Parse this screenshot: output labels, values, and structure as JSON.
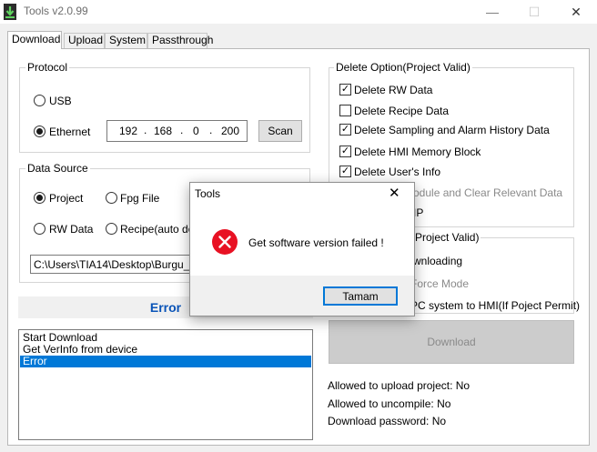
{
  "window": {
    "title": "Tools v2.0.99",
    "minimize": "—",
    "maximize": "☐",
    "close": "✕"
  },
  "tabs": [
    "Download",
    "Upload",
    "System",
    "Passthrough"
  ],
  "protocol": {
    "legend": "Protocol",
    "usb_label": "USB",
    "ethernet_label": "Ethernet",
    "selected": "Ethernet",
    "ip": [
      "192",
      "168",
      "0",
      "200"
    ],
    "scan_label": "Scan"
  },
  "data_source": {
    "legend": "Data Source",
    "project_label": "Project",
    "fpg_label": "Fpg File",
    "rw_label": "RW Data",
    "recipe_label": "Recipe(auto dele",
    "selected": "Project",
    "path": "C:\\Users\\TIA14\\Desktop\\Burgu_Ma"
  },
  "status_text": "Error",
  "log": [
    "Start Download",
    "Get VerInfo from device",
    "Error"
  ],
  "delete_options": {
    "legend": "Delete Option(Project Valid)",
    "items": [
      {
        "label": "Delete RW Data",
        "checked": "✓"
      },
      {
        "label": "Delete Recipe Data",
        "checked": ""
      },
      {
        "label": "Delete Sampling and Alarm History Data",
        "checked": "✓"
      },
      {
        "label": "Delete HMI Memory Block",
        "checked": "✓"
      },
      {
        "label": "Delete User's Info",
        "checked": "✓"
      }
    ],
    "partial_1": "odule and Clear Relevant Data",
    "partial_2": "IP"
  },
  "download_options": {
    "legend_partial": "(Project Valid)",
    "partial_1": "wnloading",
    "partial_2": "Force Mode",
    "partial_3": "PC system to HMI(If Poject Permit)"
  },
  "download_button": "Download",
  "info": {
    "upload": "Allowed to upload project: No",
    "uncompile": "Allowed to uncompile: No",
    "password": "Download password: No"
  },
  "dialog": {
    "title": "Tools",
    "message": "Get software version failed !",
    "ok_label": "Tamam",
    "close": "✕"
  },
  "colors": {
    "status": "#0a54b8",
    "selection": "#0078d7",
    "error_icon": "#e81123"
  }
}
